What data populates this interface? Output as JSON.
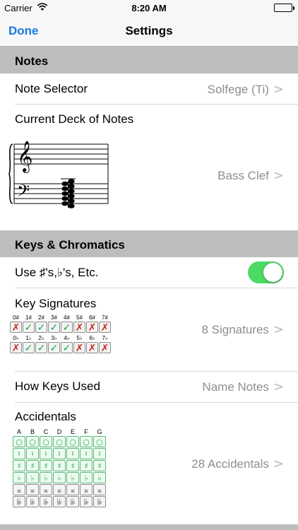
{
  "status_bar": {
    "carrier": "Carrier",
    "time": "8:20 AM"
  },
  "nav": {
    "done_label": "Done",
    "title": "Settings"
  },
  "sections": {
    "notes": {
      "header": "Notes"
    },
    "keys": {
      "header": "Keys & Chromatics"
    }
  },
  "rows": {
    "note_selector": {
      "label": "Note Selector",
      "value": "Solfege (Ti)"
    },
    "current_deck": {
      "label": "Current Deck of Notes",
      "value": "Bass Clef"
    },
    "use_sharps": {
      "label": "Use ♯'s,♭'s, Etc.",
      "enabled": true
    },
    "key_signatures": {
      "label": "Key Signatures",
      "value": "8 Signatures"
    },
    "how_keys_used": {
      "label": "How Keys Used",
      "value": "Name Notes"
    },
    "accidentals": {
      "label": "Accidentals",
      "value": "28 Accidentals"
    }
  },
  "key_signatures": {
    "sharps": [
      "0#",
      "1#",
      "2#",
      "3#",
      "4#",
      "5#",
      "6#",
      "7#"
    ],
    "sharps_enabled": [
      false,
      true,
      true,
      true,
      true,
      false,
      false,
      false
    ],
    "flats": [
      "0♭",
      "1♭",
      "2♭",
      "3♭",
      "4♭",
      "5♭",
      "6♭",
      "7♭"
    ],
    "flats_enabled": [
      false,
      true,
      true,
      true,
      true,
      false,
      false,
      false
    ],
    "check_glyph": "✓",
    "cross_glyph": "✗"
  },
  "accidentals": {
    "notes": [
      "A",
      "B",
      "C",
      "D",
      "E",
      "F",
      "G"
    ],
    "rows": [
      {
        "glyph": "○",
        "enabled": [
          true,
          true,
          true,
          true,
          true,
          true,
          true
        ]
      },
      {
        "glyph": "♮",
        "enabled": [
          true,
          true,
          true,
          true,
          true,
          true,
          true
        ]
      },
      {
        "glyph": "♯",
        "enabled": [
          true,
          true,
          true,
          true,
          true,
          true,
          true
        ]
      },
      {
        "glyph": "♭",
        "enabled": [
          true,
          true,
          true,
          true,
          true,
          true,
          true
        ]
      },
      {
        "glyph": "𝄪",
        "enabled": [
          false,
          false,
          false,
          false,
          false,
          false,
          false
        ]
      },
      {
        "glyph": "𝄫",
        "enabled": [
          false,
          false,
          false,
          false,
          false,
          false,
          false
        ]
      }
    ]
  },
  "colors": {
    "accent": "#1a7ae0",
    "toggle_on": "#4cd964",
    "check": "#1aa84a",
    "cross": "#c8281e",
    "section_bg": "#bdbdbd"
  },
  "icons": {
    "wifi": "wifi-icon",
    "battery": "battery-icon",
    "chevron": "chevron-right-icon",
    "treble_clef": "treble-clef-icon",
    "bass_clef": "bass-clef-icon"
  }
}
